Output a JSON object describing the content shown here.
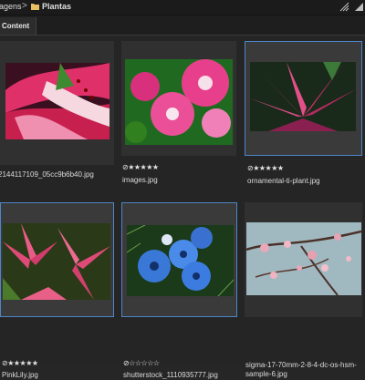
{
  "breadcrumb": {
    "parent": "agens",
    "separator": ">",
    "current": "Plantas"
  },
  "tabs": [
    {
      "label": "Content"
    }
  ],
  "items": [
    {
      "filename": "2144117109_05cc9b6b40.jpg",
      "rating": ""
    },
    {
      "filename": "images.jpg",
      "rating": "⊘★★★★★"
    },
    {
      "filename": "ornamental-ti-plant.jpg",
      "rating": "⊘★★★★★"
    },
    {
      "filename": "PinkLily.jpg",
      "rating": "⊘★★★★★"
    },
    {
      "filename": "shutterstock_1110935777.jpg",
      "rating": "⊘☆☆☆☆☆"
    },
    {
      "filename": "sigma-17-70mm-2-8-4-dc-os-hsm-sample-6.jpg",
      "rating": ""
    }
  ],
  "colors": {
    "selection": "#4d86c8",
    "panel": "#252525",
    "card": "#303030"
  }
}
